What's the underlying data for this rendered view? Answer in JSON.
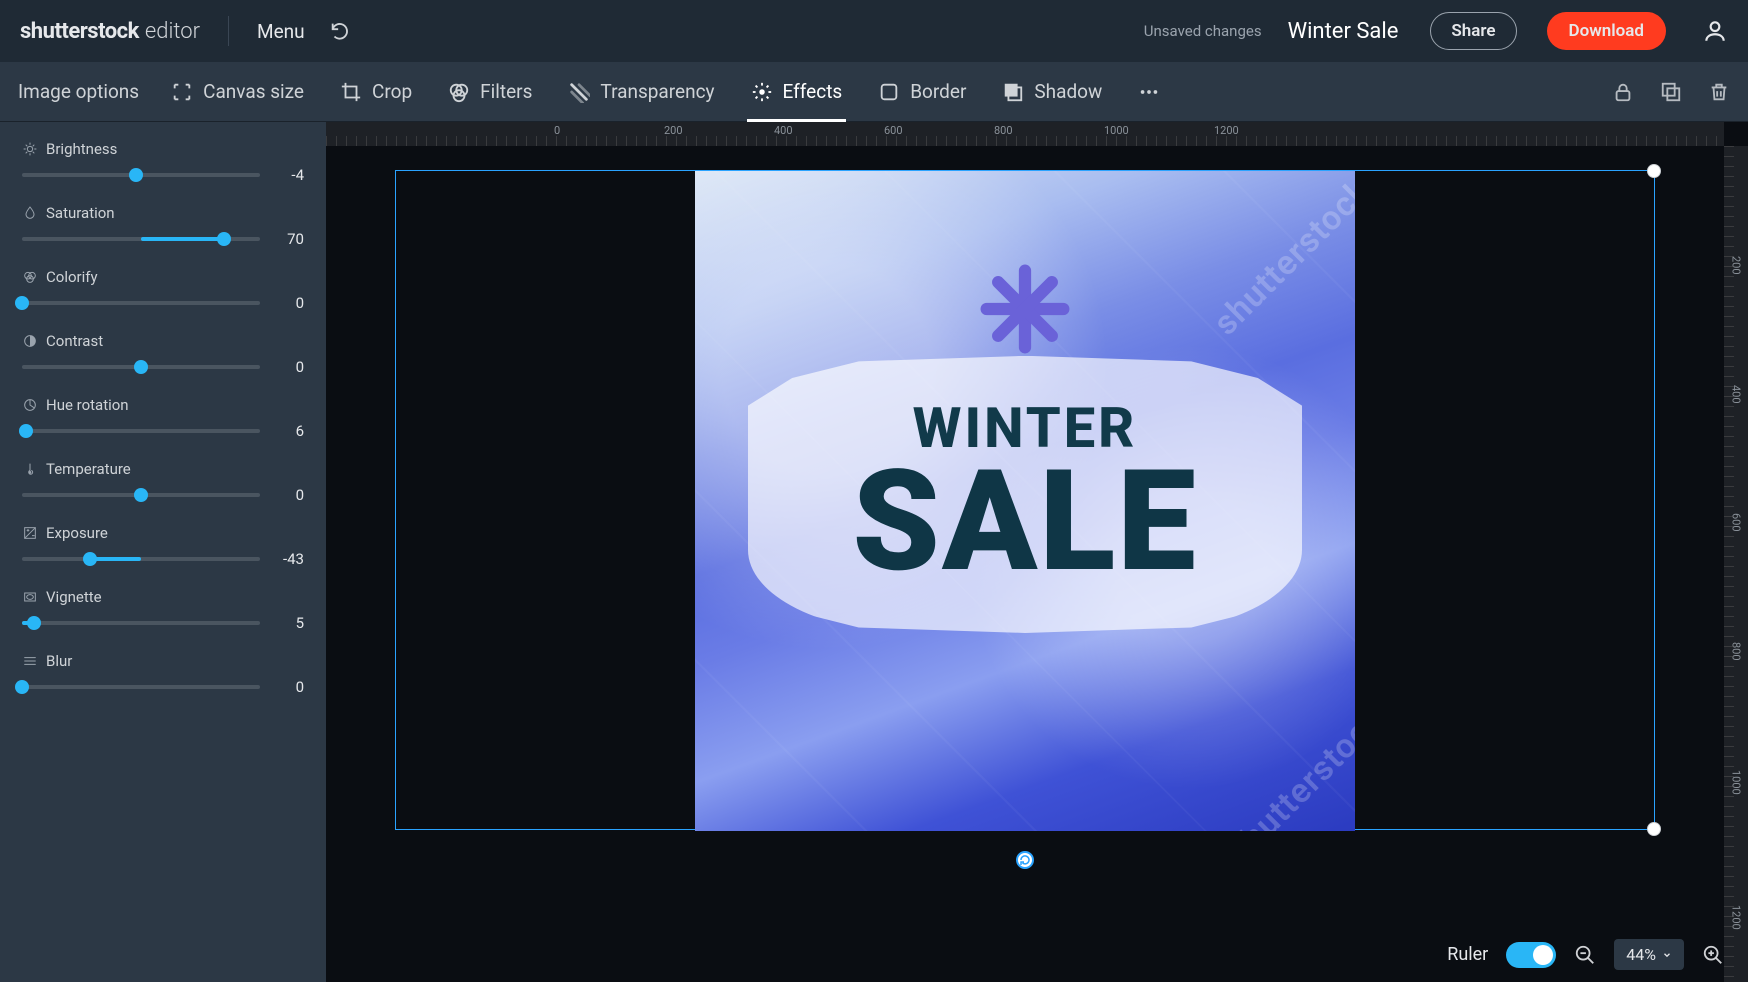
{
  "app": {
    "logo_main": "shutterstock",
    "logo_sub": "editor"
  },
  "header": {
    "menu": "Menu",
    "unsaved": "Unsaved changes",
    "title": "Winter Sale",
    "share": "Share",
    "download": "Download"
  },
  "toolbar": {
    "image_options": "Image options",
    "canvas_size": "Canvas size",
    "crop": "Crop",
    "filters": "Filters",
    "transparency": "Transparency",
    "effects": "Effects",
    "border": "Border",
    "shadow": "Shadow"
  },
  "effects": [
    {
      "label": "Brightness",
      "value": -4,
      "min": -100,
      "max": 100,
      "center": true,
      "icon": "brightness"
    },
    {
      "label": "Saturation",
      "value": 70,
      "min": -100,
      "max": 100,
      "center": true,
      "icon": "saturation"
    },
    {
      "label": "Colorify",
      "value": 0,
      "min": 0,
      "max": 100,
      "center": false,
      "icon": "colorify"
    },
    {
      "label": "Contrast",
      "value": 0,
      "min": -100,
      "max": 100,
      "center": true,
      "icon": "contrast"
    },
    {
      "label": "Hue rotation",
      "value": 6,
      "min": 0,
      "max": 360,
      "center": false,
      "icon": "hue"
    },
    {
      "label": "Temperature",
      "value": 0,
      "min": -100,
      "max": 100,
      "center": true,
      "icon": "temperature"
    },
    {
      "label": "Exposure",
      "value": -43,
      "min": -100,
      "max": 100,
      "center": true,
      "icon": "exposure"
    },
    {
      "label": "Vignette",
      "value": 5,
      "min": 0,
      "max": 100,
      "center": false,
      "icon": "vignette"
    },
    {
      "label": "Blur",
      "value": 0,
      "min": 0,
      "max": 100,
      "center": false,
      "icon": "blur"
    }
  ],
  "ruler": {
    "top_ticks": [
      "0",
      "200",
      "400",
      "600",
      "800",
      "1000",
      "1200"
    ],
    "right_ticks": [
      "200",
      "400",
      "600",
      "800",
      "1000",
      "1200"
    ]
  },
  "artwork": {
    "line1": "WINTER",
    "line2": "SALE",
    "watermark": "shutterstock"
  },
  "footer": {
    "ruler_label": "Ruler",
    "ruler_on": true,
    "zoom": "44%"
  }
}
